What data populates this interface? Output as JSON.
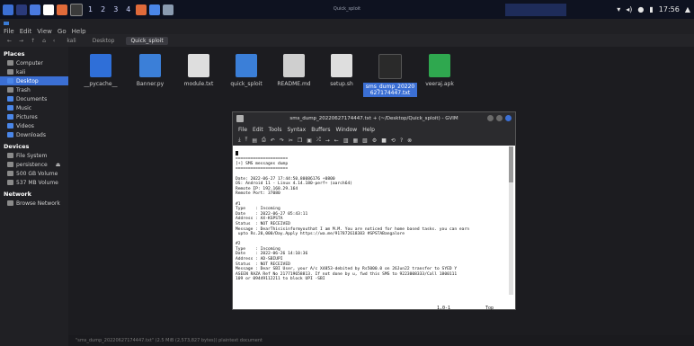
{
  "taskbar": {
    "workspaces": [
      "1",
      "2",
      "3",
      "4"
    ],
    "window_title": "Quick_sploit",
    "clock": "17:56",
    "accent": "#1e2c5a"
  },
  "filemanager": {
    "menu": [
      "File",
      "Edit",
      "View",
      "Go",
      "Help"
    ],
    "breadcrumbs": [
      "kali",
      "Desktop",
      "Quick_sploit"
    ],
    "sidebar": {
      "places_title": "Places",
      "places": [
        "Computer",
        "kali",
        "Desktop",
        "Trash",
        "Documents",
        "Music",
        "Pictures",
        "Videos",
        "Downloads"
      ],
      "devices_title": "Devices",
      "devices": [
        "File System",
        "persistence",
        "500 GB Volume",
        "537 MB Volume"
      ],
      "network_title": "Network",
      "network": [
        "Browse Network"
      ]
    },
    "files": [
      {
        "name": "__pycache__",
        "icon": "folder-icon",
        "color": "#2f6fd8"
      },
      {
        "name": "Banner.py",
        "icon": "python-file-icon",
        "color": "#3b7fd8"
      },
      {
        "name": "module.txt",
        "icon": "text-file-icon",
        "color": "#dedede"
      },
      {
        "name": "quick_sploit",
        "icon": "python-file-icon",
        "color": "#3b7fd8"
      },
      {
        "name": "README.md",
        "icon": "markdown-file-icon",
        "color": "#cfcfcf"
      },
      {
        "name": "setup.sh",
        "icon": "script-file-icon",
        "color": "#dedede"
      },
      {
        "name": "sms_dump_20220627174447.txt",
        "icon": "text-file-icon",
        "color": "#2a2a2a",
        "selected": true
      },
      {
        "name": "veeraj.apk",
        "icon": "android-package-icon",
        "color": "#2fa84f"
      }
    ],
    "status": "\"sms_dump_20220627174447.txt\" (2.5 MiB (2,573,827 bytes)) plaintext document"
  },
  "gvim": {
    "title": "sms_dump_20220627174447.txt + (~/Desktop/Quick_sploit) - GVIM",
    "menu": [
      "File",
      "Edit",
      "Tools",
      "Syntax",
      "Buffers",
      "Window",
      "Help"
    ],
    "lines": [
      "",
      "=====================",
      "[+] SMS messages dump",
      "=====================",
      "",
      "Date: 2022-06-27 17:44:50.80086176 +0800",
      "OS: Android 11 - Linux 4.14.180-perf+ (aarch64)",
      "Remote IP: 192.168.29.164",
      "Remote Port: 37080",
      "",
      "#1",
      "Type    : Incoming",
      "Date    : 2022-06-27 05:43:11",
      "Address : AX-KSPSTA",
      "Status  : NOT RECEIVED",
      "Message : DearThisisinformyouthat I am M.M. You are noticed for home based tasks. you can earn",
      " upto Rs.20,000/Day.Apply https://wa.me/917872618383 #SPSTABangalore",
      "",
      "#2",
      "Type    : Incoming",
      "Date    : 2022-06-26 14:10:36",
      "Address : AD-SBIUPI",
      "Status  : NOT RECEIVED",
      "Message : Dear SBI User, your A/c X4853-debited by Rs5000.0 on 26Jun22 transfer to SYED Y",
      "ASEEN RAZA Ref No 217719658813. If not done by u, fwd this SMS to 9223008333/Call 1800111",
      "109 or 09449112211 to block UPI -SBI"
    ],
    "position": "1,0-1",
    "percent": "Top"
  }
}
